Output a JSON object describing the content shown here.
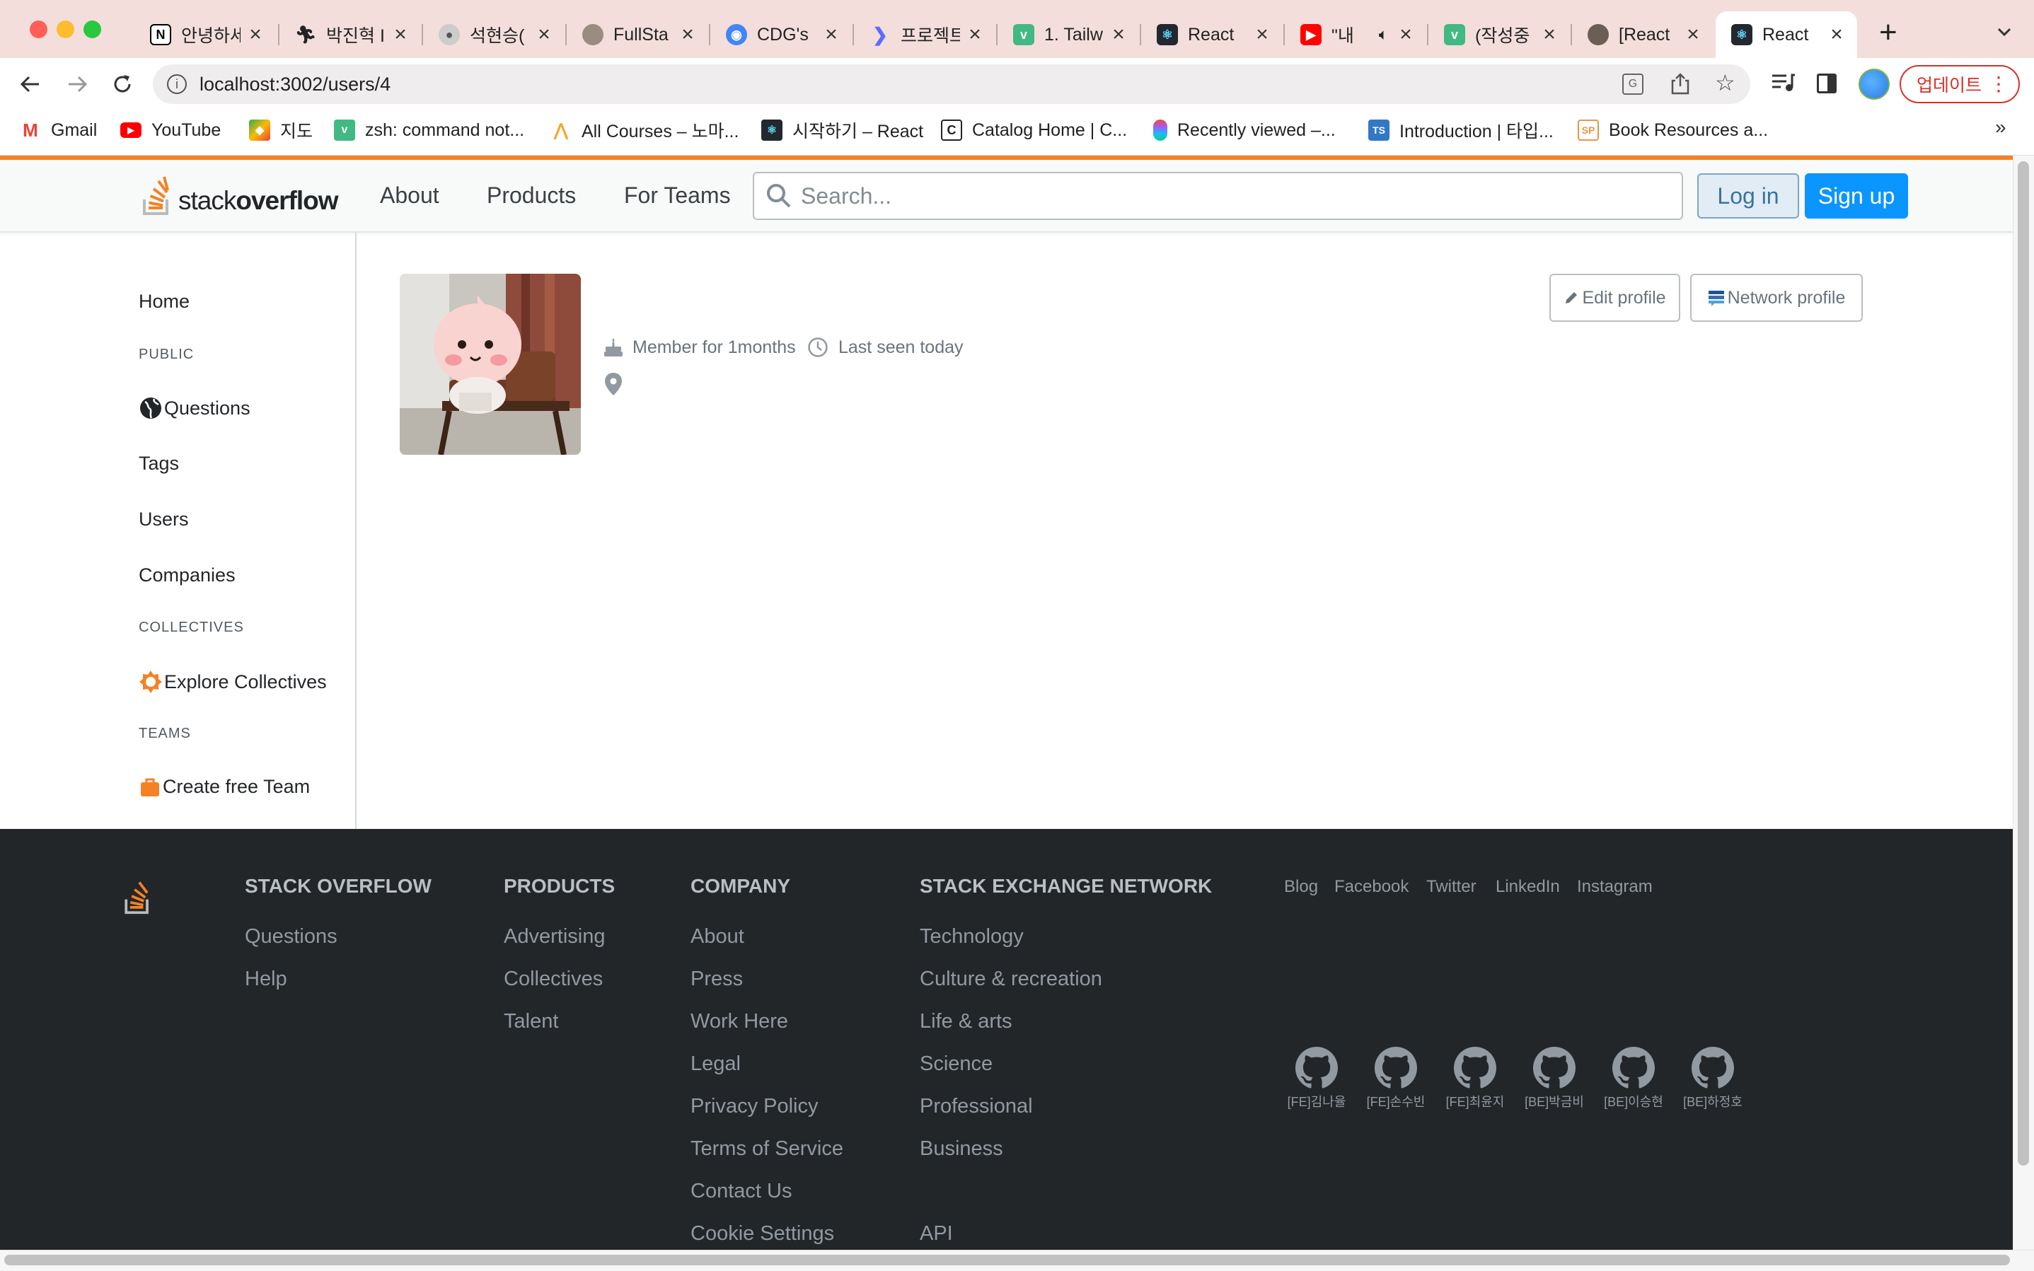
{
  "browser": {
    "tabs": [
      {
        "title": "안녕하세",
        "icon": "notion-icon",
        "color": "#000000"
      },
      {
        "title": "박진혁 I",
        "icon": "runner-icon",
        "color": "#333333"
      },
      {
        "title": "석현승(",
        "icon": "user-icon",
        "color": "#888888"
      },
      {
        "title": "FullSta",
        "icon": "avatar-icon",
        "color": "#777777"
      },
      {
        "title": "CDG's",
        "icon": "docs-icon",
        "color": "#4285f4"
      },
      {
        "title": "프로젝트",
        "icon": "diamond-icon",
        "color": "#5f6bff"
      },
      {
        "title": "1. Tailw",
        "icon": "v-icon",
        "color": "#42b883"
      },
      {
        "title": "React",
        "icon": "react-icon",
        "color": "#23272f"
      },
      {
        "title": "\"내",
        "icon": "youtube-icon",
        "color": "#ff0000"
      },
      {
        "title": "(작성중",
        "icon": "v-icon",
        "color": "#42b883"
      },
      {
        "title": "[React",
        "icon": "avatar-icon",
        "color": "#666666"
      },
      {
        "title": "React",
        "icon": "react-icon",
        "color": "#23272f"
      }
    ],
    "url": "localhost:3002/users/4",
    "update_label": "업데이트",
    "bookmarks": [
      {
        "label": "Gmail",
        "icon": "gmail-icon"
      },
      {
        "label": "YouTube",
        "icon": "youtube-icon"
      },
      {
        "label": "지도",
        "icon": "maps-icon"
      },
      {
        "label": "zsh: command not...",
        "icon": "v-icon"
      },
      {
        "label": "All Courses – 노마...",
        "icon": "nomad-icon"
      },
      {
        "label": "시작하기 – React",
        "icon": "react-icon"
      },
      {
        "label": "Catalog Home | C...",
        "icon": "catalog-icon"
      },
      {
        "label": "Recently viewed –...",
        "icon": "figma-icon"
      },
      {
        "label": "Introduction | 타입...",
        "icon": "ts-icon"
      },
      {
        "label": "Book Resources a...",
        "icon": "sp-icon"
      }
    ],
    "bookmarks_more": "»"
  },
  "header": {
    "logo_text_light": "stack",
    "logo_text_bold": "overflow",
    "nav": [
      "About",
      "Products",
      "For Teams"
    ],
    "search_placeholder": "Search...",
    "login": "Log in",
    "signup": "Sign up"
  },
  "sidebar": {
    "home": "Home",
    "public_label": "PUBLIC",
    "questions": "Questions",
    "tags": "Tags",
    "users": "Users",
    "companies": "Companies",
    "collectives_label": "COLLECTIVES",
    "explore_collectives": "Explore Collectives",
    "teams_label": "TEAMS",
    "create_team": "Create free Team"
  },
  "profile": {
    "member_for": "Member for 1months",
    "last_seen": "Last seen today",
    "edit_profile": "Edit profile",
    "network_profile": "Network profile"
  },
  "footer": {
    "columns": [
      {
        "title": "STACK OVERFLOW",
        "links": [
          "Questions",
          "Help"
        ]
      },
      {
        "title": "PRODUCTS",
        "links": [
          "Advertising",
          "Collectives",
          "Talent"
        ]
      },
      {
        "title": "COMPANY",
        "links": [
          "About",
          "Press",
          "Work Here",
          "Legal",
          "Privacy Policy",
          "Terms of Service",
          "Contact Us",
          "Cookie Settings"
        ]
      },
      {
        "title": "STACK EXCHANGE NETWORK",
        "links": [
          "Technology",
          "Culture & recreation",
          "Life & arts",
          "Science",
          "Professional",
          "Business",
          "",
          "API"
        ]
      }
    ],
    "social": [
      "Blog",
      "Facebook",
      "Twitter",
      "LinkedIn",
      "Instagram"
    ],
    "github_members": [
      "[FE]김나율",
      "[FE]손수빈",
      "[FE]최윤지",
      "[BE]박금비",
      "[BE]이승현",
      "[BE]하정호"
    ]
  },
  "colors": {
    "brand_orange": "#f48225",
    "signup_blue": "#0a95ff",
    "footer_bg": "#232629"
  }
}
